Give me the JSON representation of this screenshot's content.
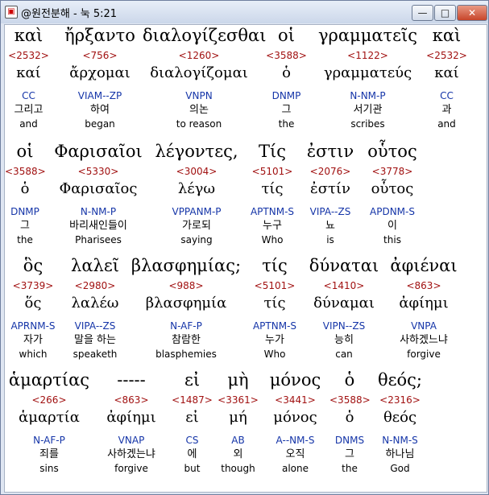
{
  "window": {
    "title": "@원전분해 - 눅 5:21",
    "minimize_symbol": "—",
    "maximize_symbol": "□",
    "close_symbol": "✕",
    "app_icon": "book-icon"
  },
  "rows": [
    {
      "words": [
        {
          "greek": "καὶ",
          "strong": "<2532>",
          "lemma": "καί",
          "parse": "CC",
          "korean": "그리고",
          "english": "and"
        },
        {
          "greek": "ἤρξαντο",
          "strong": "<756>",
          "lemma": "ἄρχομαι",
          "parse": "VIAM--ZP",
          "korean": "하여",
          "english": "began"
        },
        {
          "greek": "διαλογίζεσθαι",
          "strong": "<1260>",
          "lemma": "διαλογίζομαι",
          "parse": "VNPN",
          "korean": "의논",
          "english": "to reason"
        },
        {
          "greek": "οἱ",
          "strong": "<3588>",
          "lemma": "ὁ",
          "parse": "DNMP",
          "korean": "그",
          "english": "the"
        },
        {
          "greek": "γραμματεῖς",
          "strong": "<1122>",
          "lemma": "γραμματεύς",
          "parse": "N-NM-P",
          "korean": "서기관",
          "english": "scribes"
        },
        {
          "greek": "καὶ",
          "strong": "<2532>",
          "lemma": "καί",
          "parse": "CC",
          "korean": "과",
          "english": "and"
        }
      ]
    },
    {
      "words": [
        {
          "greek": "οἱ",
          "strong": "<3588>",
          "lemma": "ὁ",
          "parse": "DNMP",
          "korean": "그",
          "english": "the"
        },
        {
          "greek": "Φαρισαῖοι",
          "strong": "<5330>",
          "lemma": "Φαρισαῖος",
          "parse": "N-NM-P",
          "korean": "바리새인들이",
          "english": "Pharisees"
        },
        {
          "greek": "λέγοντες,",
          "strong": "<3004>",
          "lemma": "λέγω",
          "parse": "VPPANM-P",
          "korean": "가로되",
          "english": "saying"
        },
        {
          "greek": "Τίς",
          "strong": "<5101>",
          "lemma": "τίς",
          "parse": "APTNM-S",
          "korean": "누구",
          "english": "Who"
        },
        {
          "greek": "ἐστιν",
          "strong": "<2076>",
          "lemma": "ἐστίν",
          "parse": "VIPA--ZS",
          "korean": "뇨",
          "english": "is"
        },
        {
          "greek": "οὗτος",
          "strong": "<3778>",
          "lemma": "οὗτος",
          "parse": "APDNM-S",
          "korean": "이",
          "english": "this"
        }
      ]
    },
    {
      "words": [
        {
          "greek": "ὃς",
          "strong": "<3739>",
          "lemma": "ὅς",
          "parse": "APRNM-S",
          "korean": "자가",
          "english": "which"
        },
        {
          "greek": "λαλεῖ",
          "strong": "<2980>",
          "lemma": "λαλέω",
          "parse": "VIPA--ZS",
          "korean": "말을 하는",
          "english": "speaketh"
        },
        {
          "greek": "βλασφημίας;",
          "strong": "<988>",
          "lemma": "βλασφημία",
          "parse": "N-AF-P",
          "korean": "참람한",
          "english": "blasphemies"
        },
        {
          "greek": "τίς",
          "strong": "<5101>",
          "lemma": "τίς",
          "parse": "APTNM-S",
          "korean": "누가",
          "english": "Who"
        },
        {
          "greek": "δύναται",
          "strong": "<1410>",
          "lemma": "δύναμαι",
          "parse": "VIPN--ZS",
          "korean": "능히",
          "english": "can"
        },
        {
          "greek": "ἀφιέναι",
          "strong": "<863>",
          "lemma": "ἀφίημι",
          "parse": "VNPA",
          "korean": "사하겠느냐",
          "english": "forgive"
        }
      ]
    },
    {
      "words": [
        {
          "greek": "ἁμαρτίας",
          "strong": "<266>",
          "lemma": "ἁμαρτία",
          "parse": "N-AF-P",
          "korean": "죄를",
          "english": "sins"
        },
        {
          "greek": "-----",
          "strong": "<863>",
          "lemma": "ἀφίημι",
          "parse": "VNAP",
          "korean": "사하겠는냐",
          "english": "forgive"
        },
        {
          "greek": "εἰ",
          "strong": "<1487>",
          "lemma": "εἰ",
          "parse": "CS",
          "korean": "에",
          "english": "but"
        },
        {
          "greek": "μὴ",
          "strong": "<3361>",
          "lemma": "μή",
          "parse": "AB",
          "korean": "외",
          "english": "though"
        },
        {
          "greek": "μόνος",
          "strong": "<3441>",
          "lemma": "μόνος",
          "parse": "A--NM-S",
          "korean": "오직",
          "english": "alone"
        },
        {
          "greek": "ὁ",
          "strong": "<3588>",
          "lemma": "ὁ",
          "parse": "DNMS",
          "korean": "그",
          "english": "the"
        },
        {
          "greek": "θεός;",
          "strong": "<2316>",
          "lemma": "θεός",
          "parse": "N-NM-S",
          "korean": "하나님",
          "english": "God"
        }
      ]
    }
  ]
}
